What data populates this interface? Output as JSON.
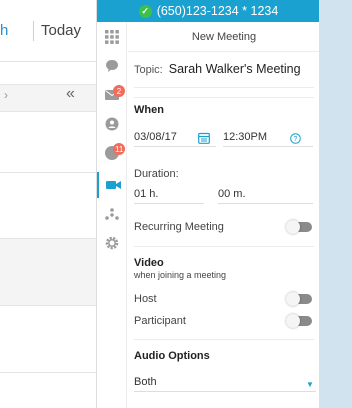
{
  "background": {
    "month_label": "h",
    "today_label": "Today",
    "collapse_glyph": "«"
  },
  "phone_bar": {
    "text": "(650)123-1234 * 1234",
    "status_color": "#3dc14a",
    "bar_color": "#1aa1cf"
  },
  "side_nav": {
    "items": [
      {
        "icon": "grid-icon"
      },
      {
        "icon": "chat-icon"
      },
      {
        "icon": "mail-icon",
        "badge": "2"
      },
      {
        "icon": "contact-icon"
      },
      {
        "icon": "notification-icon",
        "badge": "11"
      },
      {
        "icon": "video-icon",
        "active": true
      },
      {
        "icon": "network-icon"
      },
      {
        "icon": "settings-icon"
      }
    ]
  },
  "meeting": {
    "header": "New Meeting",
    "topic_label": "Topic:",
    "topic_value": "Sarah Walker's Meeting",
    "when_label": "When",
    "date": "03/08/17",
    "time": "12:30PM",
    "duration_label": "Duration:",
    "duration_hours": "01 h.",
    "duration_minutes": "00 m.",
    "recurring_label": "Recurring Meeting",
    "video_label": "Video",
    "video_sub": "when joining a meeting",
    "host_label": "Host",
    "participant_label": "Participant",
    "audio_label": "Audio Options",
    "audio_value": "Both"
  }
}
